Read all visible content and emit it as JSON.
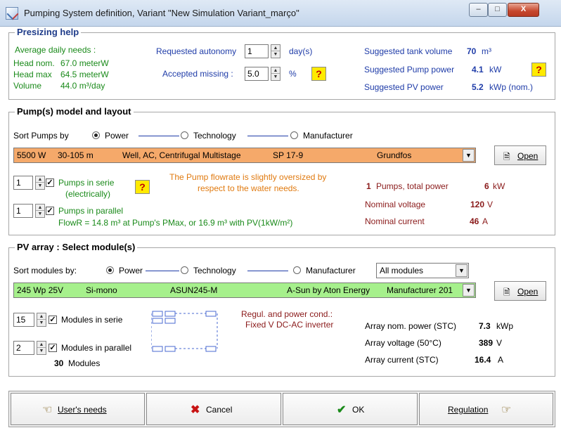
{
  "window": {
    "title": "Pumping System definition, Variant  \"New Simulation Variant_março\"",
    "min_glyph": "–",
    "max_glyph": "□",
    "close_glyph": "X"
  },
  "presizing": {
    "title": "Presizing help",
    "avg_daily_label": "Average daily needs :",
    "head_nom_label": "Head nom.",
    "head_nom_value": "67.0 meterW",
    "head_max_label": "Head max",
    "head_max_value": "64.5 meterW",
    "volume_label": "Volume",
    "volume_value": "44.0 m³/day",
    "autonomy_label": "Requested autonomy",
    "autonomy_value": "1",
    "autonomy_unit": "day(s)",
    "missing_label": "Accepted missing :",
    "missing_value": "5.0",
    "missing_unit": "%",
    "help_glyph": "?",
    "tank_label": "Suggested tank volume",
    "tank_value": "70",
    "tank_unit": "m³",
    "pump_power_label": "Suggested Pump power",
    "pump_power_value": "4.1",
    "pump_power_unit": "kW",
    "pv_power_label": "Suggested PV power",
    "pv_power_value": "5.2",
    "pv_power_unit": "kWp (nom.)"
  },
  "pump": {
    "title": "Pump(s)  model and layout",
    "sort_label": "Sort Pumps by",
    "sort_options": [
      "Power",
      "Technology",
      "Manufacturer"
    ],
    "selected_power": "5500 W",
    "selected_head": "30-105 m",
    "selected_type": "Well, AC, Centrifugal Multistage",
    "selected_model": "SP 17-9",
    "selected_manufacturer": "Grundfos",
    "open_label": "Open",
    "serie_value": "1",
    "serie_label": "Pumps in serie",
    "serie_sub": "(electrically)",
    "parallel_value": "1",
    "parallel_label": "Pumps in parallel",
    "flow_text": "FlowR = 14.8 m³ at Pump's PMax, or 16.9 m³ with PV(1kW/m²)",
    "warning_line1": "The Pump flowrate is slightly oversized by",
    "warning_line2": "respect to the water needs.",
    "count_value": "1",
    "count_label": "Pumps,  total power",
    "total_power_value": "6",
    "total_power_unit": "kW",
    "voltage_label": "Nominal voltage",
    "voltage_value": "120",
    "voltage_unit": "V",
    "current_label": "Nominal current",
    "current_value": "46",
    "current_unit": "A"
  },
  "pv": {
    "title": "PV array : Select module(s)",
    "sort_label": "Sort modules by:",
    "sort_options": [
      "Power",
      "Technology",
      "Manufacturer"
    ],
    "filter_value": "All modules",
    "selected_power": "245 Wp 25V",
    "selected_tech": "Si-mono",
    "selected_model": "ASUN245-M",
    "selected_manufacturer": "A-Sun by Aton Energy",
    "selected_source": "Manufacturer 201",
    "open_label": "Open",
    "serie_value": "15",
    "serie_label": "Modules in serie",
    "parallel_value": "2",
    "parallel_label": "Modules in parallel",
    "module_count": "30",
    "module_count_label": "Modules",
    "regul_line1": "Regul. and power cond.:",
    "regul_line2": "Fixed V DC-AC inverter",
    "array_power_label": "Array nom. power (STC)",
    "array_power_value": "7.3",
    "array_power_unit": "kWp",
    "array_voltage_label": "Array voltage  (50°C)",
    "array_voltage_value": "389",
    "array_voltage_unit": "V",
    "array_current_label": "Array current  (STC)",
    "array_current_value": "16.4",
    "array_current_unit": "A"
  },
  "buttons": {
    "users_needs": "User's needs",
    "cancel": "Cancel",
    "ok": "OK",
    "regulation": "Regulation"
  },
  "colors": {
    "pump_selection_bg": "#f5a96a",
    "pv_selection_bg": "#a6f08c",
    "title_blue": "#1f3c8a",
    "label_green": "#1a8a1a",
    "label_blue": "#1f3ca8",
    "value_maroon": "#8a1a1a",
    "warning_orange": "#e07a10",
    "help_yellow": "#ffea00"
  }
}
